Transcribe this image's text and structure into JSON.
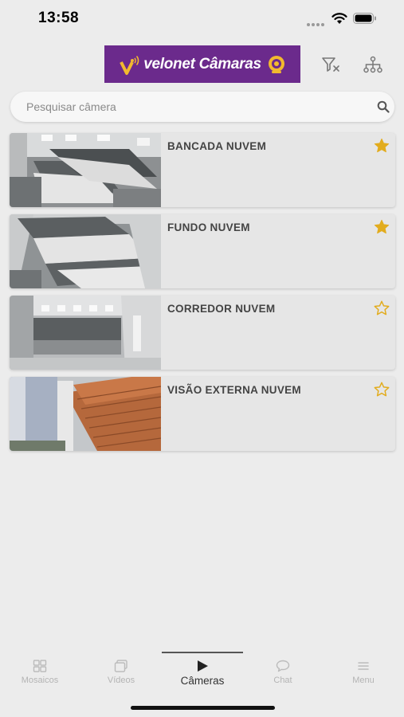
{
  "status_bar": {
    "time": "13:58",
    "icons": [
      "signal-dots-icon",
      "wifi-icon",
      "battery-icon"
    ]
  },
  "header": {
    "logo_text": "velonet Câmaras",
    "logo_colors": {
      "background": "#6b2a8c",
      "accent": "#f2b92e"
    },
    "icons": [
      "filter-clear-icon",
      "hierarchy-icon"
    ]
  },
  "search": {
    "placeholder": "Pesquisar câmera",
    "value": ""
  },
  "cameras": [
    {
      "name": "BANCADA NUVEM",
      "favorite": true
    },
    {
      "name": "FUNDO NUVEM",
      "favorite": true
    },
    {
      "name": "CORREDOR NUVEM",
      "favorite": false
    },
    {
      "name": "VISÃO EXTERNA NUVEM",
      "favorite": false
    }
  ],
  "colors": {
    "star": "#e2ac1e",
    "background": "#ececec",
    "card": "#e6e6e6"
  },
  "bottom_nav": {
    "items": [
      {
        "label": "Mosaicos",
        "icon": "grid-icon",
        "active": false
      },
      {
        "label": "Vídeos",
        "icon": "videos-icon",
        "active": false
      },
      {
        "label": "Câmeras",
        "icon": "play-icon",
        "active": true
      },
      {
        "label": "Chat",
        "icon": "chat-icon",
        "active": false
      },
      {
        "label": "Menu",
        "icon": "menu-icon",
        "active": false
      }
    ]
  }
}
